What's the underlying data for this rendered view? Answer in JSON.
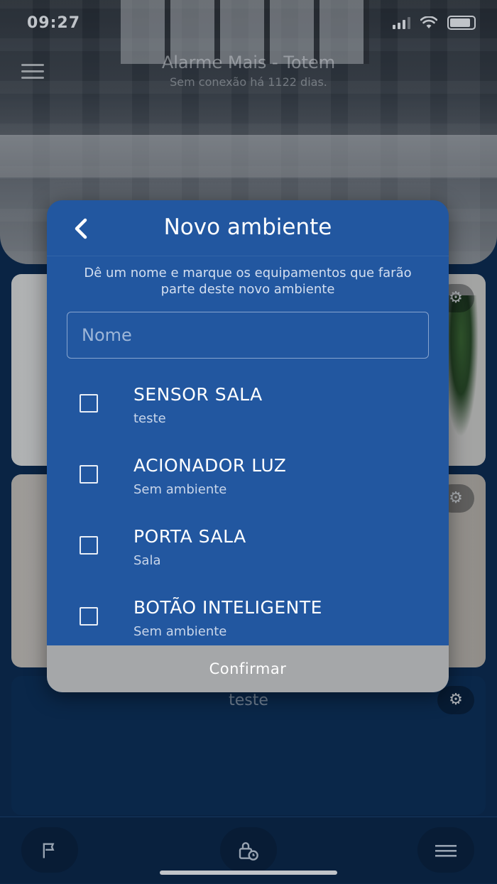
{
  "status_bar": {
    "time": "09:27"
  },
  "app": {
    "title": "Alarme Mais - Totem",
    "subtitle": "Sem conexão há 1122 dias."
  },
  "cards": [
    {
      "title": ""
    },
    {
      "title": ""
    },
    {
      "title": "teste"
    }
  ],
  "modal": {
    "title": "Novo ambiente",
    "description": "Dê um nome e marque os equipamentos que farão parte deste novo ambiente",
    "name_placeholder": "Nome",
    "name_value": "",
    "items": [
      {
        "name": "SENSOR SALA",
        "env": "teste",
        "checked": false
      },
      {
        "name": "ACIONADOR LUZ",
        "env": "Sem ambiente",
        "checked": false
      },
      {
        "name": "PORTA SALA",
        "env": "Sala",
        "checked": false
      },
      {
        "name": "BOTÃO INTELIGENTE",
        "env": "Sem ambiente",
        "checked": false
      }
    ],
    "confirm_label": "Confirmar"
  },
  "icons": {
    "back": "chevron-left-icon",
    "gear": "gear-icon",
    "flag": "flag-icon",
    "lock_clock": "lock-clock-icon",
    "menu": "menu-icon"
  },
  "colors": {
    "modal_bg": "#2257a0",
    "confirm_bg": "#a5a7a9",
    "app_bg": "#0c2a4e"
  }
}
